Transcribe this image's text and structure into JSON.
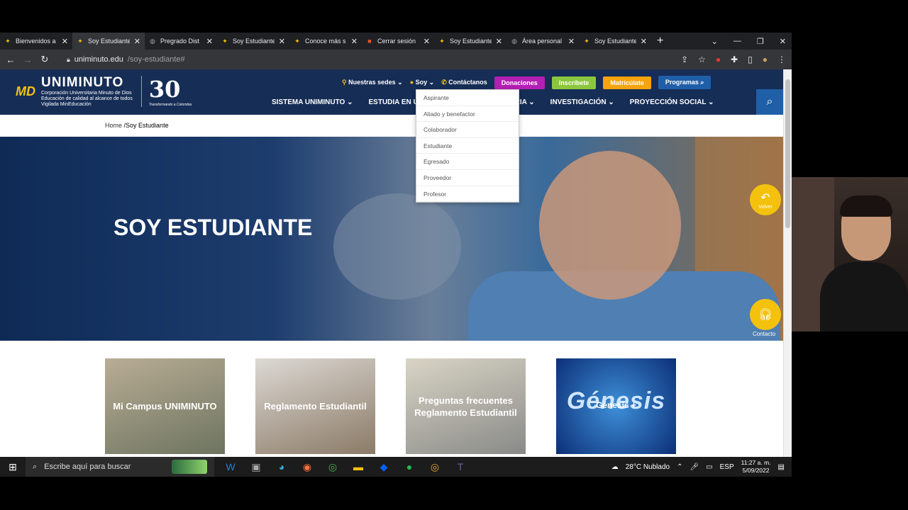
{
  "browser": {
    "tabs": [
      {
        "title": "Bienvenidos a",
        "active": false,
        "icon": "uniminuto-favicon"
      },
      {
        "title": "Soy Estudiante",
        "active": true,
        "icon": "uniminuto-favicon"
      },
      {
        "title": "Pregrado Dist",
        "active": false,
        "icon": "globe-favicon"
      },
      {
        "title": "Soy Estudiante",
        "active": false,
        "icon": "uniminuto-favicon"
      },
      {
        "title": "Conoce más s",
        "active": false,
        "icon": "uniminuto-favicon"
      },
      {
        "title": "Cerrar sesión",
        "active": false,
        "icon": "microsoft-favicon"
      },
      {
        "title": "Soy Estudiante",
        "active": false,
        "icon": "uniminuto-favicon"
      },
      {
        "title": "Área personal",
        "active": false,
        "icon": "globe-favicon"
      },
      {
        "title": "Soy Estudiante",
        "active": false,
        "icon": "uniminuto-favicon"
      }
    ],
    "url_domain": "uniminuto.edu",
    "url_path": "/soy-estudiante#"
  },
  "site": {
    "logo_main": "UNIMINUTO",
    "logo_md": "MD",
    "logo_line1": "Corporación Universitaria Minuto de Dios",
    "logo_line2": "Educación de calidad al alcance de todos",
    "logo_line3": "Vigilada MinEducación",
    "logo_30": "30",
    "logo_30_tag": "Transformando a Colombia",
    "topnav": {
      "sedes": "Nuestras sedes",
      "soy": "Soy",
      "contacto": "Contáctanos",
      "donaciones": "Donaciones",
      "inscribete": "Inscríbete",
      "matriculate": "Matricúlate",
      "programas": "Programas"
    },
    "mainnav": [
      "SISTEMA UNIMINUTO",
      "ESTUDIA EN U",
      "ERSITARIA",
      "INVESTIGACIÓN",
      "PROYECCIÓN SOCIAL"
    ],
    "dropdown": [
      "Aspirante",
      "Aliado y benefactor",
      "Colaborador",
      "Estudiante",
      "Egresado",
      "Proveedor",
      "Profesor"
    ],
    "breadcrumb_home": "Home",
    "breadcrumb_current": "/Soy Estudiante",
    "hero_title": "SOY ESTUDIANTE",
    "volver": "Volver",
    "contacto_btn": "Contacto",
    "cards": [
      "Mi Campus UNIMINUTO",
      "Reglamento Estudiantil",
      "Preguntas frecuentes Reglamento Estudiantil",
      "Génesis +"
    ],
    "card4_logo": "Génesis"
  },
  "taskbar": {
    "search_placeholder": "Escribe aquí para buscar",
    "weather": "28°C Nublado",
    "lang": "ESP",
    "time": "11:27 a. m.",
    "date": "5/09/2022"
  }
}
